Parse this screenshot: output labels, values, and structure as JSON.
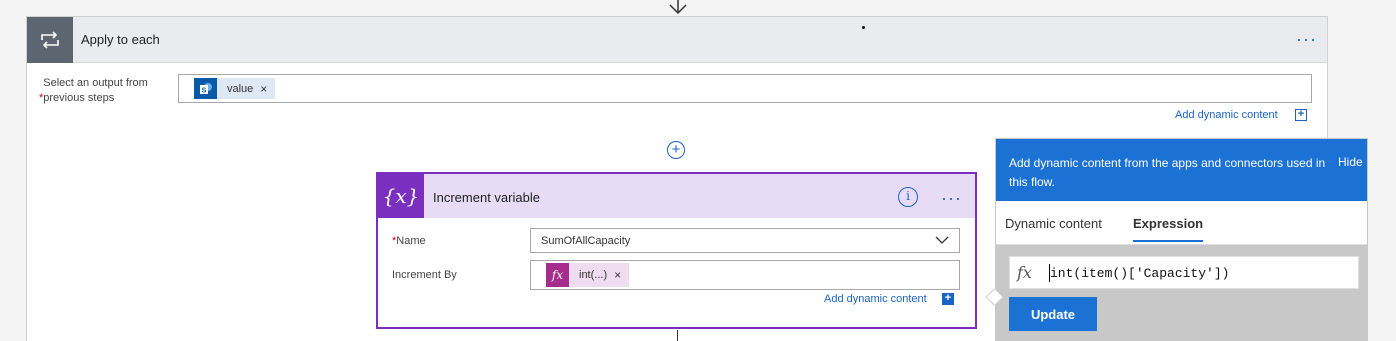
{
  "scope": {
    "title": "Apply to each",
    "icon": "loop-icon",
    "more": "···",
    "output_label": "Select an output from previous steps",
    "required_mark": "*",
    "output_token": "value",
    "output_token_icon": "sharepoint-icon",
    "token_remove": "×",
    "add_dynamic_content": "Add dynamic content",
    "add_dynamic_plus": "+"
  },
  "add_step": "+",
  "card": {
    "icon_text": "{x}",
    "title": "Increment variable",
    "info": "i",
    "more": "···",
    "name_label": "Name",
    "required_mark": "*",
    "name_value": "SumOfAllCapacity",
    "increment_label": "Increment By",
    "increment_token": "int(...)",
    "fx_icon": "fx",
    "token_remove": "×",
    "add_dynamic_content": "Add dynamic content",
    "add_dynamic_plus": "+"
  },
  "panel": {
    "description": "Add dynamic content from the apps and connectors used in this flow.",
    "hide": "Hide",
    "tabs": [
      {
        "label": "Dynamic content",
        "active": false
      },
      {
        "label": "Expression",
        "active": true
      }
    ],
    "fx_icon": "fx",
    "expression": "int(item()['Capacity'])",
    "update": "Update"
  },
  "colors": {
    "accent": "#1b72d4",
    "variable_purple": "#7b2fbe",
    "fx_magenta": "#a62d8e",
    "scope_gray": "#5d6670"
  }
}
